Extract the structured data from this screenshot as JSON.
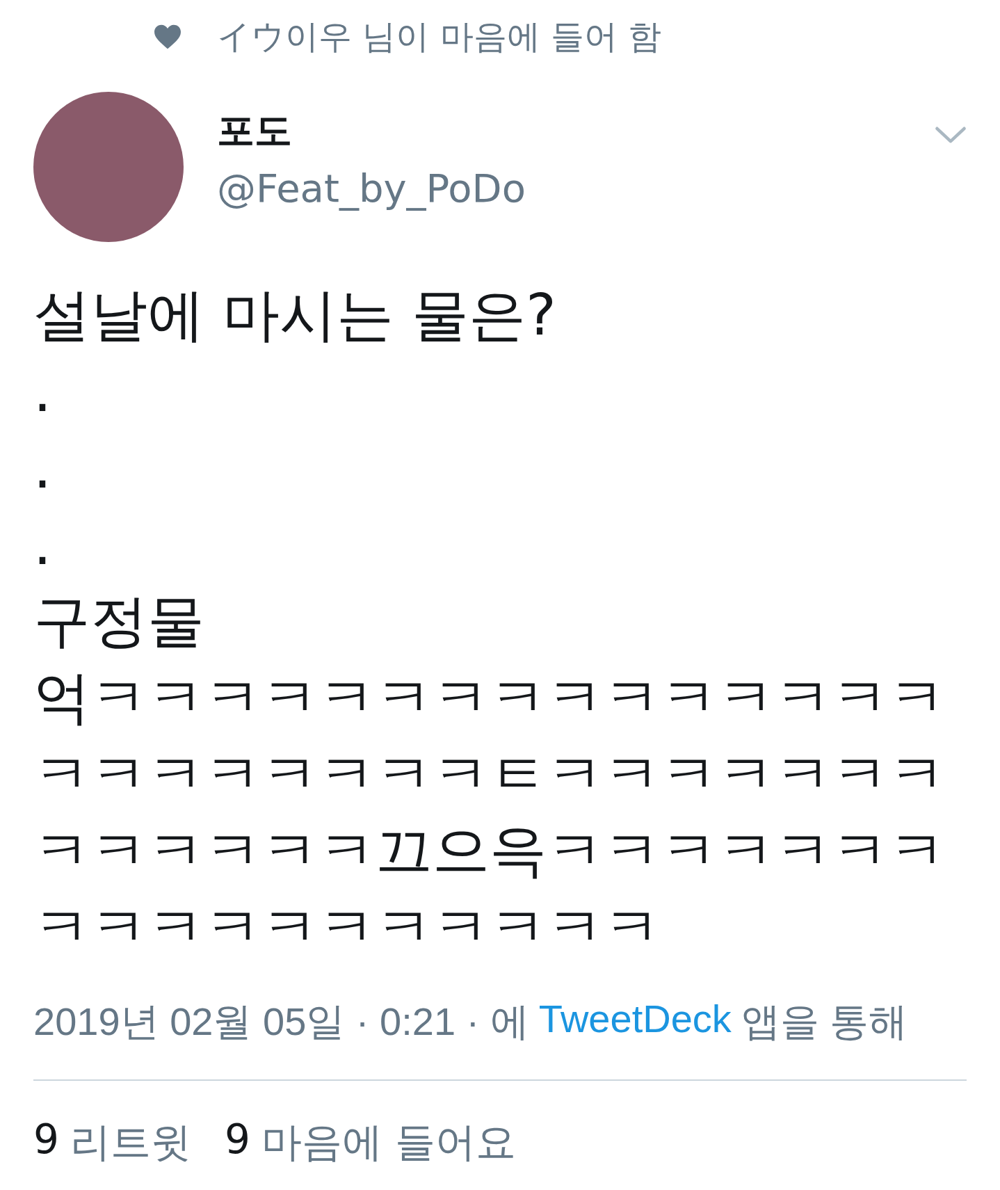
{
  "social_context": {
    "text": "イウ이우 님이 마음에 들어 함"
  },
  "author": {
    "name": "포도",
    "handle": "@Feat_by_PoDo"
  },
  "body": {
    "lines": [
      "설날에 마시는 물은?",
      ".",
      ".",
      ".",
      "구정물",
      "억ㅋㅋㅋㅋㅋㅋㅋㅋㅋㅋㅋㅋㅋㅋㅋ",
      "ㅋㅋㅋㅋㅋㅋㅋㅋㅌㅋㅋㅋㅋㅋㅋㅋ",
      "ㅋㅋㅋㅋㅋㅋ끄으윽ㅋㅋㅋㅋㅋㅋㅋ",
      "ㅋㅋㅋㅋㅋㅋㅋㅋㅋㅋㅋ"
    ]
  },
  "meta": {
    "timestamp": "2019년 02월 05일 · 0:21 · 에",
    "source": "TweetDeck",
    "source_suffix": "앱을 통해"
  },
  "stats": [
    {
      "count": "9",
      "label": "리트윗"
    },
    {
      "count": "9",
      "label": "마음에 들어요"
    }
  ]
}
